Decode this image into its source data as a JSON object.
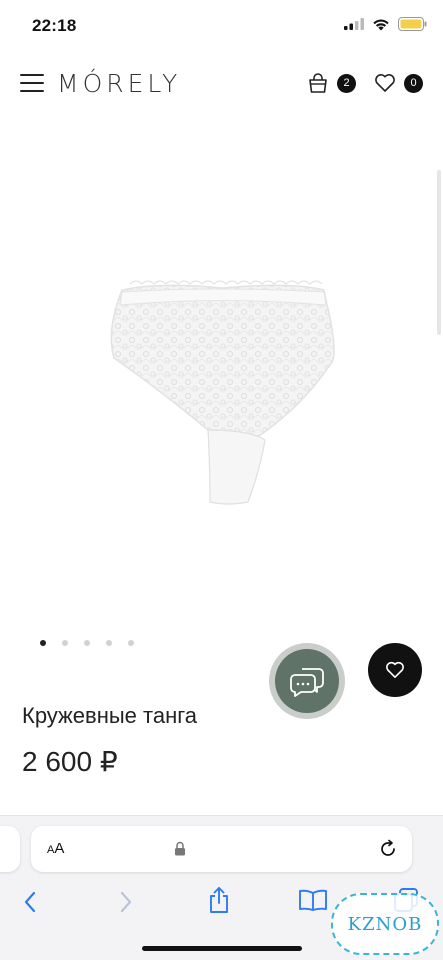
{
  "status_bar": {
    "time": "22:18"
  },
  "header": {
    "logo": "MÓRELY",
    "cart_count": "2",
    "wishlist_count": "0"
  },
  "gallery": {
    "slides_total": 5,
    "active_slide": 1
  },
  "product": {
    "title": "Кружевные танга",
    "price": "2 600 ₽"
  },
  "browser": {
    "text_size_label_small": "A",
    "text_size_label_large": "A"
  },
  "watermark": {
    "text": "KZNOB"
  },
  "colors": {
    "chat_button": "#5f7368",
    "chat_ring": "#c9ceca",
    "fav_button": "#111111",
    "battery": "#f2d04a",
    "watermark": "#39b5d8"
  }
}
